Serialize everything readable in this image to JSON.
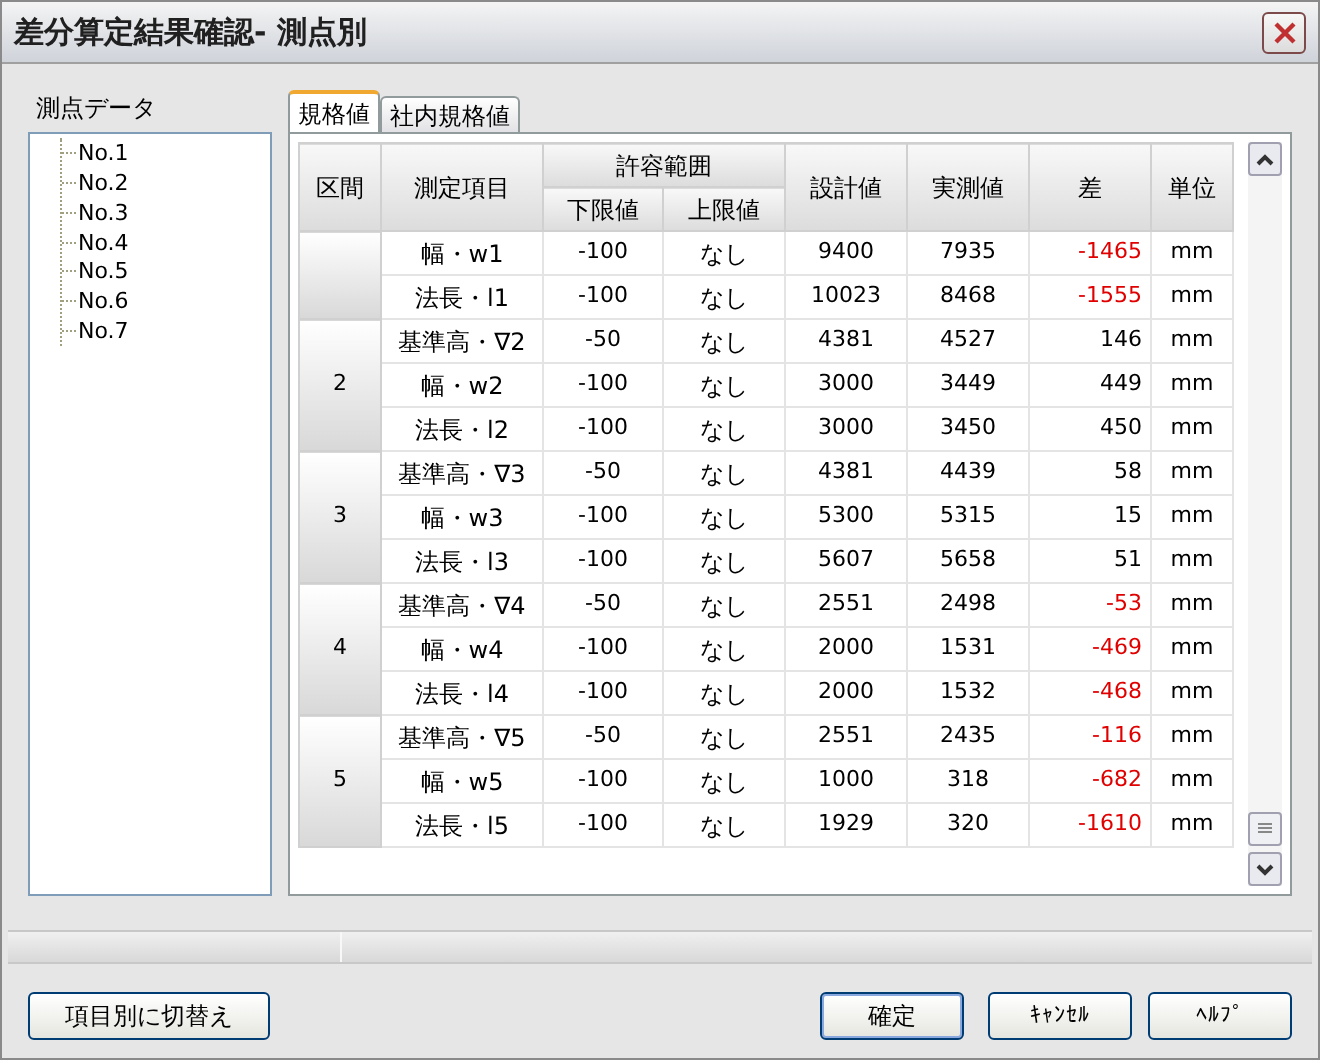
{
  "window": {
    "title": "差分算定結果確認- 測点別"
  },
  "tree": {
    "label": "測点データ",
    "items": [
      {
        "label": "No.1",
        "selected": false
      },
      {
        "label": "No.2",
        "selected": false
      },
      {
        "label": "No.3",
        "selected": false
      },
      {
        "label": "No.4",
        "selected": false
      },
      {
        "label": "No.5",
        "selected": false
      },
      {
        "label": "No.6",
        "selected": false
      },
      {
        "label": "No.7",
        "selected": false
      }
    ]
  },
  "tabs": [
    {
      "label": "規格値",
      "selected": true
    },
    {
      "label": "社内規格値",
      "selected": false
    }
  ],
  "table": {
    "columns": {
      "section": "区間",
      "item": "測定項目",
      "tolerance": "許容範囲",
      "lower": "下限値",
      "upper": "上限値",
      "design": "設計値",
      "measured": "実測値",
      "diff": "差",
      "unit": "単位"
    },
    "groups": [
      {
        "rows": [
          {
            "item": "幅・w1",
            "lower": "-100",
            "upper": "なし",
            "design": "9400",
            "measured": "7935",
            "diff": "-1465",
            "alert": true,
            "unit": "mm"
          },
          {
            "item": "法長・l1",
            "lower": "-100",
            "upper": "なし",
            "design": "10023",
            "measured": "8468",
            "diff": "-1555",
            "alert": true,
            "unit": "mm"
          }
        ]
      },
      {
        "section": "2",
        "rows": [
          {
            "item": "基準高・∇2",
            "lower": "-50",
            "upper": "なし",
            "design": "4381",
            "measured": "4527",
            "diff": "146",
            "alert": false,
            "unit": "mm"
          },
          {
            "item": "幅・w2",
            "lower": "-100",
            "upper": "なし",
            "design": "3000",
            "measured": "3449",
            "diff": "449",
            "alert": false,
            "unit": "mm"
          },
          {
            "item": "法長・l2",
            "lower": "-100",
            "upper": "なし",
            "design": "3000",
            "measured": "3450",
            "diff": "450",
            "alert": false,
            "unit": "mm"
          }
        ]
      },
      {
        "section": "3",
        "rows": [
          {
            "item": "基準高・∇3",
            "lower": "-50",
            "upper": "なし",
            "design": "4381",
            "measured": "4439",
            "diff": "58",
            "alert": false,
            "unit": "mm"
          },
          {
            "item": "幅・w3",
            "lower": "-100",
            "upper": "なし",
            "design": "5300",
            "measured": "5315",
            "diff": "15",
            "alert": false,
            "unit": "mm"
          },
          {
            "item": "法長・l3",
            "lower": "-100",
            "upper": "なし",
            "design": "5607",
            "measured": "5658",
            "diff": "51",
            "alert": false,
            "unit": "mm"
          }
        ]
      },
      {
        "section": "4",
        "rows": [
          {
            "item": "基準高・∇4",
            "lower": "-50",
            "upper": "なし",
            "design": "2551",
            "measured": "2498",
            "diff": "-53",
            "alert": true,
            "unit": "mm"
          },
          {
            "item": "幅・w4",
            "lower": "-100",
            "upper": "なし",
            "design": "2000",
            "measured": "1531",
            "diff": "-469",
            "alert": true,
            "unit": "mm"
          },
          {
            "item": "法長・l4",
            "lower": "-100",
            "upper": "なし",
            "design": "2000",
            "measured": "1532",
            "diff": "-468",
            "alert": true,
            "unit": "mm"
          }
        ]
      },
      {
        "section": "5",
        "rows": [
          {
            "item": "基準高・∇5",
            "lower": "-50",
            "upper": "なし",
            "design": "2551",
            "measured": "2435",
            "diff": "-116",
            "alert": true,
            "unit": "mm"
          },
          {
            "item": "幅・w5",
            "lower": "-100",
            "upper": "なし",
            "design": "1000",
            "measured": "318",
            "diff": "-682",
            "alert": true,
            "unit": "mm"
          },
          {
            "item": "法長・l5",
            "lower": "-100",
            "upper": "なし",
            "design": "1929",
            "measured": "320",
            "diff": "-1610",
            "alert": true,
            "unit": "mm"
          }
        ]
      }
    ]
  },
  "buttons": {
    "switch": "項目別に切替え",
    "ok": "確定",
    "cancel": "ｷｬﾝｾﾙ",
    "help": "ﾍﾙﾌﾟ"
  }
}
